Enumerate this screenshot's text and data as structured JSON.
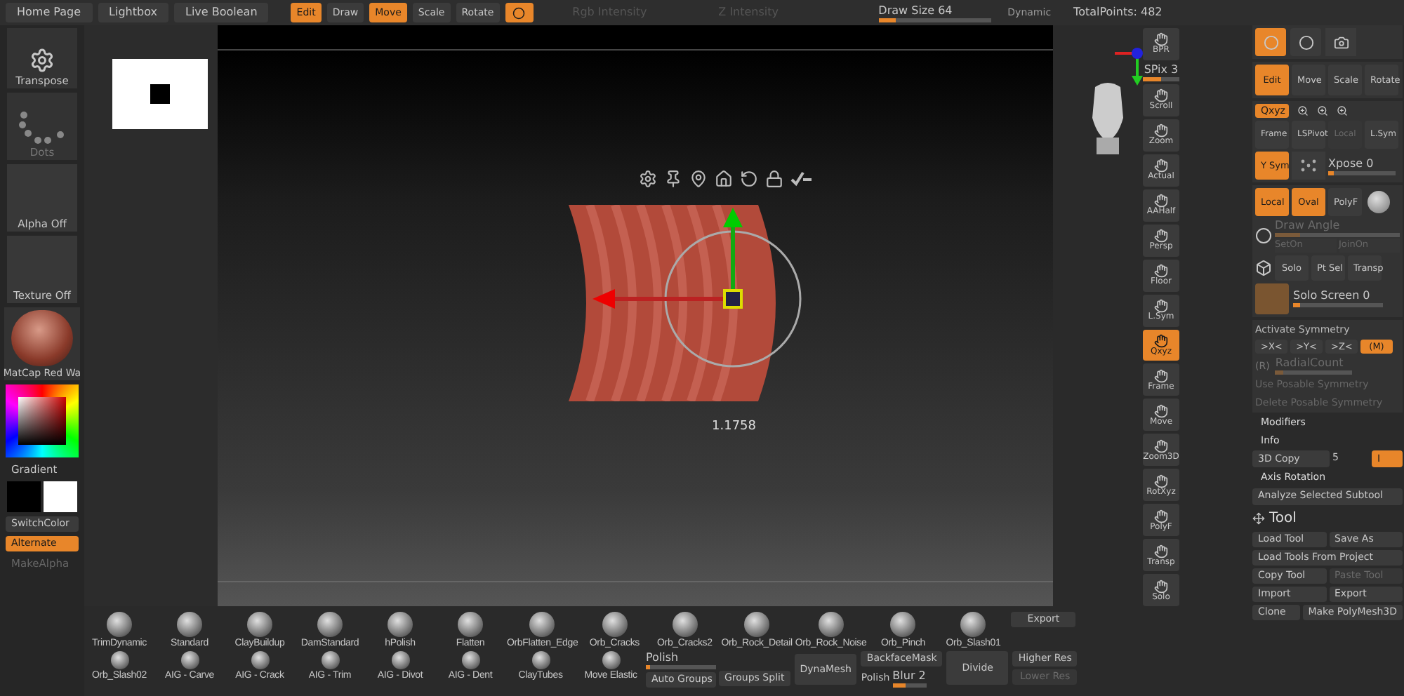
{
  "top_bar": {
    "tabs": [
      "Home Page",
      "Lightbox",
      "Live Boolean"
    ],
    "tools": [
      {
        "label": "Edit",
        "active": true
      },
      {
        "label": "Draw",
        "active": false
      },
      {
        "label": "Move",
        "active": true
      },
      {
        "label": "Scale",
        "active": false
      },
      {
        "label": "Rotate",
        "active": false
      }
    ],
    "rgb_intensity": "Rgb Intensity",
    "z_intensity": "Z Intensity",
    "draw_size": {
      "label": "Draw Size 64",
      "level": 0.15
    },
    "dynamic": "Dynamic",
    "total_points": "TotalPoints: 482"
  },
  "left_shelf": {
    "transpose": "Transpose",
    "dots": "Dots",
    "alpha": "Alpha Off",
    "texture": "Texture Off",
    "material": "MatCap Red Wa",
    "gradient": "Gradient",
    "switch_color": "SwitchColor",
    "alternate": {
      "label": "Alternate",
      "on": true
    },
    "make_alpha": "MakeAlpha"
  },
  "canvas": {
    "measure": "1.1758"
  },
  "right_shelf": [
    {
      "label": "BPR",
      "active": false
    },
    {
      "label": "SPix 3",
      "kind": "slider",
      "level": 0.5
    },
    {
      "label": "Scroll",
      "active": false
    },
    {
      "label": "Zoom",
      "active": false
    },
    {
      "label": "Actual",
      "active": false
    },
    {
      "label": "AAHalf",
      "active": false
    },
    {
      "label": "Persp",
      "active": false
    },
    {
      "label": "Floor",
      "active": false
    },
    {
      "label": "L.Sym",
      "active": false
    },
    {
      "label": "Qxyz",
      "active": true
    },
    {
      "label": "Frame",
      "active": false
    },
    {
      "label": "Move",
      "active": false
    },
    {
      "label": "Zoom3D",
      "active": false
    },
    {
      "label": "RotXyz",
      "active": false
    },
    {
      "label": "PolyF",
      "active": false
    },
    {
      "label": "Transp",
      "active": false
    },
    {
      "label": "Solo",
      "active": false
    }
  ],
  "tool_palette": {
    "top_buttons": [
      {
        "active": true
      },
      {
        "active": false
      }
    ],
    "transform": [
      {
        "label": "Edit",
        "active": true
      },
      {
        "label": "Move",
        "active": false
      },
      {
        "label": "Scale",
        "active": false
      },
      {
        "label": "Rotate",
        "active": false
      }
    ],
    "qxyz": {
      "label": "Qxyz",
      "active": true
    },
    "pivot_row": [
      {
        "label": "Frame",
        "disabled": false
      },
      {
        "label": "LSPivot",
        "disabled": false
      },
      {
        "label": "Local",
        "disabled": true
      },
      {
        "label": "L.Sym",
        "disabled": false
      }
    ],
    "ysym": {
      "label": "Y Sym",
      "active": true
    },
    "xpose": {
      "label": "Xpose 0",
      "level": 0.08
    },
    "draw_row": [
      {
        "label": "Local",
        "active": true
      },
      {
        "label": "Oval",
        "active": true
      },
      {
        "label": "PolyF",
        "active": false
      }
    ],
    "draw_angle": {
      "label": "Draw Angle",
      "level": 0.2
    },
    "set_row": [
      {
        "label": "SetOn"
      },
      {
        "label": "JoinOn"
      }
    ],
    "solo_row": [
      {
        "label": "Solo"
      },
      {
        "label": "Pt Sel"
      },
      {
        "label": "Transp"
      }
    ],
    "solo_screen": {
      "label": "Solo Screen 0",
      "level": 0.08
    },
    "symmetry": {
      "title": "Activate Symmetry",
      "axes": [
        {
          "label": ">X<",
          "active": false
        },
        {
          "label": ">Y<",
          "active": false
        },
        {
          "label": ">Z<",
          "active": false
        },
        {
          "label": "(M)",
          "active": true
        }
      ],
      "radial": {
        "label": "(R)",
        "slider": "RadialCount",
        "level": 0.1
      },
      "use_posable": "Use Posable Symmetry",
      "delete_posable": "Delete Posable Symmetry"
    },
    "modifiers": "Modifiers",
    "info": "Info",
    "copy": {
      "label": "3D Copy",
      "value": "5",
      "toggle": "I"
    },
    "axis_rotation": "Axis Rotation",
    "analyze": "Analyze Selected Subtool",
    "tool_title": "Tool",
    "tool_buttons": [
      [
        {
          "label": "Load Tool",
          "disabled": false
        },
        {
          "label": "Save As",
          "disabled": false
        }
      ],
      [
        {
          "label": "Load Tools From Project",
          "disabled": false
        }
      ],
      [
        {
          "label": "Copy Tool",
          "disabled": false
        },
        {
          "label": "Paste Tool",
          "disabled": true
        }
      ],
      [
        {
          "label": "Import",
          "disabled": false
        },
        {
          "label": "Export",
          "disabled": false
        }
      ],
      [
        {
          "label": "Clone",
          "disabled": false
        },
        {
          "label": "Make PolyMesh3D",
          "disabled": false
        }
      ]
    ]
  },
  "brushes": {
    "row_1": [
      "TrimDynamic",
      "Standard",
      "ClayBuildup",
      "DamStandard",
      "hPolish",
      "Flatten",
      "OrbFlatten_Edge",
      "Orb_Cracks",
      "Orb_Cracks2",
      "Orb_Rock_Detail",
      "Orb_Rock_Noise",
      "Orb_Pinch",
      "Orb_Slash01"
    ],
    "row_2": [
      "Orb_Slash02",
      "AIG - Carve",
      "AIG - Crack",
      "AIG - Trim",
      "AIG - Divot",
      "AIG - Dent",
      "ClayTubes",
      "Move Elastic"
    ],
    "export": "Export",
    "polish": {
      "label": "Polish",
      "level": 0.06
    },
    "auto_groups": "Auto Groups",
    "groups_split": "Groups Split",
    "dynamesh": "DynaMesh",
    "backface_mask": "BackfaceMask",
    "polish_label": "Polish",
    "blur": {
      "label": "Blur 2",
      "level": 0.4
    },
    "divide": "Divide",
    "higher_res": "Higher Res",
    "lower_res": {
      "label": "Lower Res",
      "disabled": true
    }
  }
}
